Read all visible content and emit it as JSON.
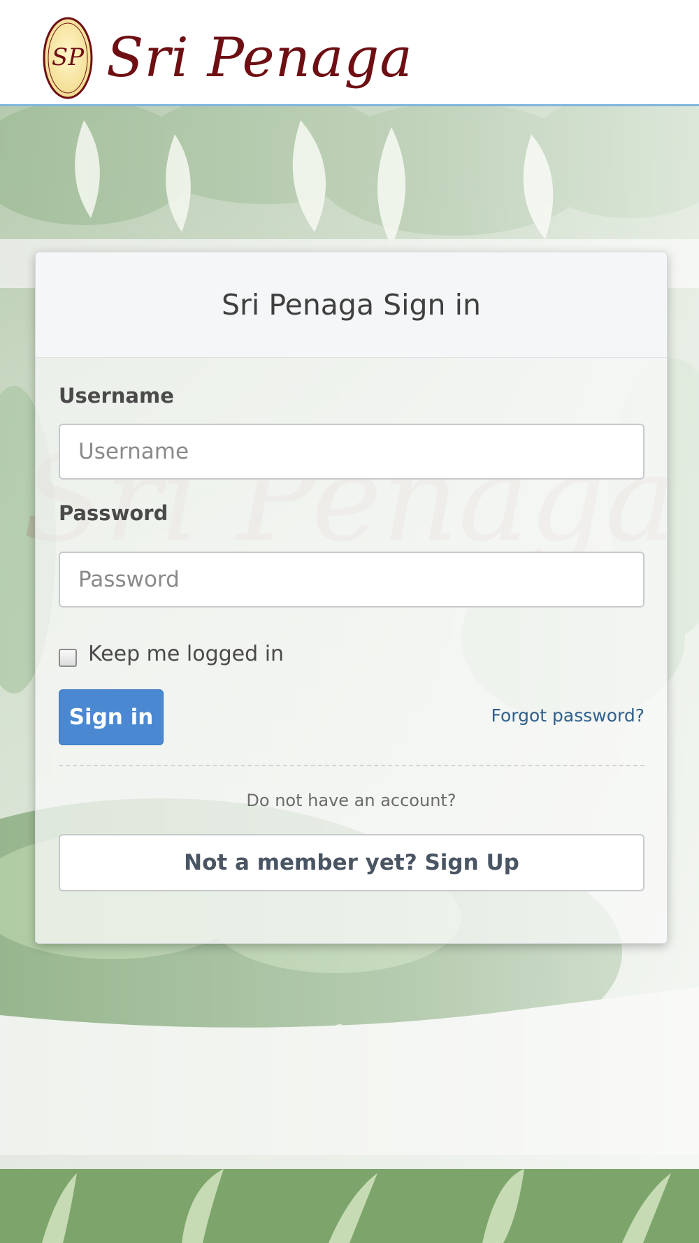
{
  "header": {
    "brand": "Sri Penaga",
    "seal_letters": "SP"
  },
  "login": {
    "title": "Sri Penaga Sign in",
    "username_label": "Username",
    "username_placeholder": "Username",
    "username_value": "",
    "password_label": "Password",
    "password_placeholder": "Password",
    "password_value": "",
    "remember_label": "Keep me logged in",
    "remember_checked": false,
    "signin_button": "Sign in",
    "forgot_link": "Forgot password?",
    "no_account_text": "Do not have an account?",
    "signup_button": "Not a member yet? Sign Up"
  },
  "colors": {
    "brand": "#6e0f14",
    "primary_button": "#4a88d1",
    "header_border": "#7fb6dd"
  }
}
